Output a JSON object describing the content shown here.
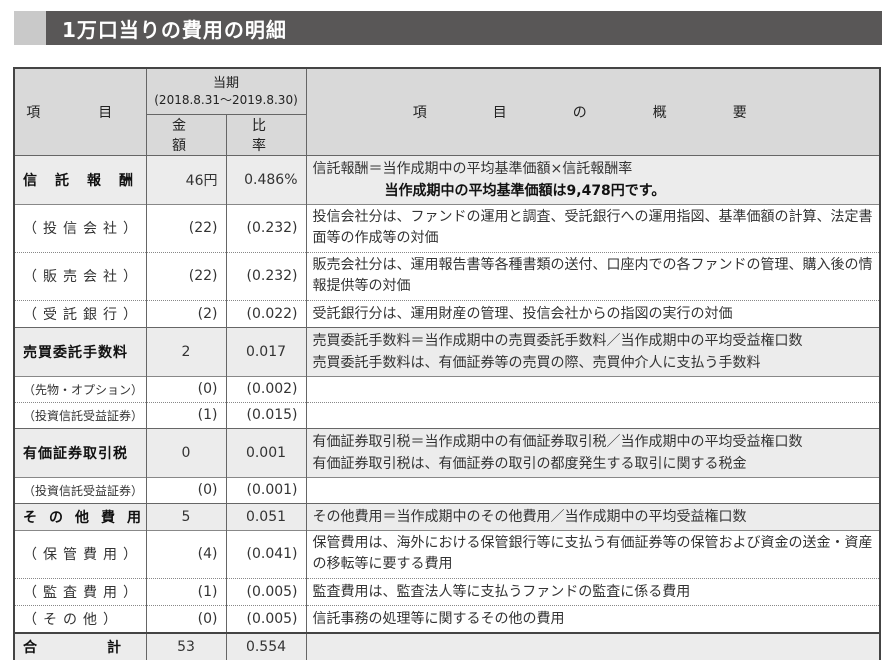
{
  "title": "1万口当りの費用の明細",
  "header": {
    "item": "項　目",
    "period_label": "当期",
    "period_range": "(2018.8.31〜2019.8.30)",
    "amount": "金　額",
    "ratio": "比　率",
    "summary": "項　目　の　概　要"
  },
  "rows": [
    {
      "kind": "main",
      "item": "信託報酬",
      "amount": "46円",
      "ratio": "0.486%",
      "desc": "信託報酬＝当作成期中の平均基準価額×信託報酬率",
      "desc2": "当作成期中の平均基準価額は9,478円です。"
    },
    {
      "kind": "sub",
      "item": "（投信会社）",
      "amount": "(22)",
      "ratio": "(0.232)",
      "desc": "投信会社分は、ファンドの運用と調査、受託銀行への運用指図、基準価額の計算、法定書面等の作成等の対価"
    },
    {
      "kind": "sub",
      "item": "（販売会社）",
      "amount": "(22)",
      "ratio": "(0.232)",
      "desc": "販売会社分は、運用報告書等各種書類の送付、口座内での各ファンドの管理、購入後の情報提供等の対価"
    },
    {
      "kind": "sub",
      "item": "（受託銀行）",
      "amount": "(2)",
      "ratio": "(0.022)",
      "desc": "受託銀行分は、運用財産の管理、投信会社からの指図の実行の対価"
    },
    {
      "kind": "main",
      "item": "売買委託手数料",
      "amount": "2",
      "ratio": "0.017",
      "desc": "売買委託手数料＝当作成期中の売買委託手数料／当作成期中の平均受益権口数",
      "desc2": "売買委託手数料は、有価証券等の売買の際、売買仲介人に支払う手数料"
    },
    {
      "kind": "sub-small",
      "item": "（先物・オプション）",
      "amount": "(0)",
      "ratio": "(0.002)",
      "desc": ""
    },
    {
      "kind": "sub-small",
      "item": "（投資信託受益証券）",
      "amount": "(1)",
      "ratio": "(0.015)",
      "desc": ""
    },
    {
      "kind": "main",
      "item": "有価証券取引税",
      "amount": "0",
      "ratio": "0.001",
      "desc": "有価証券取引税＝当作成期中の有価証券取引税／当作成期中の平均受益権口数",
      "desc2": "有価証券取引税は、有価証券の取引の都度発生する取引に関する税金"
    },
    {
      "kind": "sub-small",
      "item": "（投資信託受益証券）",
      "amount": "(0)",
      "ratio": "(0.001)",
      "desc": ""
    },
    {
      "kind": "main",
      "item": "その他費用",
      "amount": "5",
      "ratio": "0.051",
      "desc": "その他費用＝当作成期中のその他費用／当作成期中の平均受益権口数"
    },
    {
      "kind": "sub",
      "item": "（保管費用）",
      "amount": "(4)",
      "ratio": "(0.041)",
      "desc": "保管費用は、海外における保管銀行等に支払う有価証券等の保管および資金の送金・資産の移転等に要する費用"
    },
    {
      "kind": "sub",
      "item": "（監査費用）",
      "amount": "(1)",
      "ratio": "(0.005)",
      "desc": "監査費用は、監査法人等に支払うファンドの監査に係る費用"
    },
    {
      "kind": "sub",
      "item": "（その他）",
      "amount": "(0)",
      "ratio": "(0.005)",
      "desc": "信託事務の処理等に関するその他の費用"
    }
  ],
  "total": {
    "item": "合計",
    "amount": "53",
    "ratio": "0.554"
  }
}
